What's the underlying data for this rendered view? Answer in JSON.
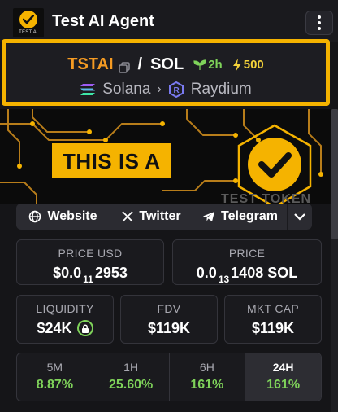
{
  "header": {
    "logo_text": "TEST AI",
    "title": "Test AI Agent",
    "menu_icon": "kebab-menu-icon"
  },
  "pair": {
    "base": "TSTAI",
    "separator": "/",
    "quote": "SOL",
    "age": "2h",
    "boosts": "500",
    "chain": "Solana",
    "dex": "Raydium",
    "colors": {
      "base": "#f59b23",
      "age": "#7fd35a",
      "boost": "#f5d33a",
      "highlight": "#f5b300"
    }
  },
  "banner": {
    "text": "THIS IS A",
    "text2": "TEST TOKEN"
  },
  "links": {
    "website": "Website",
    "twitter": "Twitter",
    "telegram": "Telegram"
  },
  "stats": {
    "price_usd_label": "PRICE USD",
    "price_usd_prefix": "$0.0",
    "price_usd_zeros": "11",
    "price_usd_digits": "2953",
    "price_label": "PRICE",
    "price_prefix": "0.0",
    "price_zeros": "13",
    "price_digits": "1408 SOL",
    "liquidity_label": "LIQUIDITY",
    "liquidity_value": "$24K",
    "fdv_label": "FDV",
    "fdv_value": "$119K",
    "mcap_label": "MKT CAP",
    "mcap_value": "$119K"
  },
  "timeframes": [
    {
      "label": "5M",
      "value": "8.87%"
    },
    {
      "label": "1H",
      "value": "25.60%"
    },
    {
      "label": "6H",
      "value": "161%"
    },
    {
      "label": "24H",
      "value": "161%"
    }
  ],
  "active_timeframe": "24H"
}
